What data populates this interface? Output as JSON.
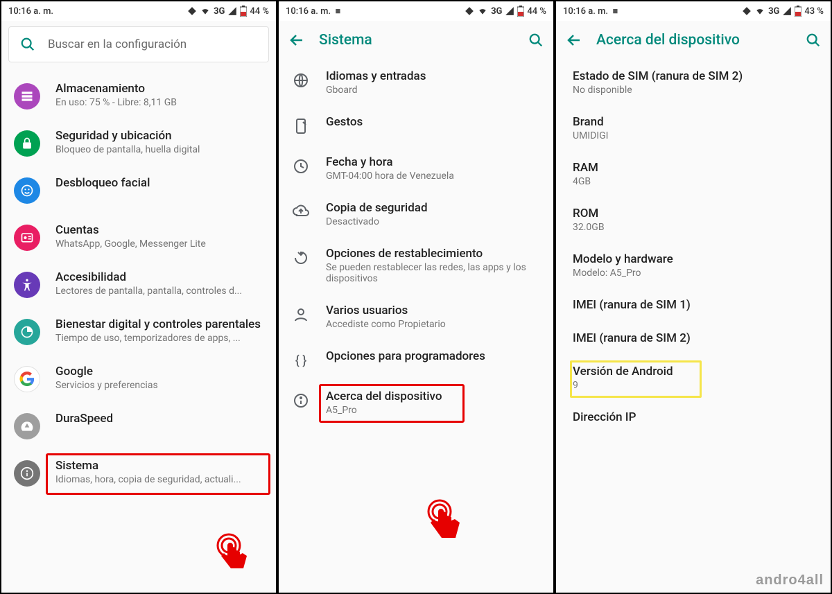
{
  "panels": [
    {
      "statusbar": {
        "time": "10:16 a. m.",
        "extra": "",
        "network": "3G",
        "battery": "44 %"
      },
      "search_placeholder": "Buscar en la configuración",
      "items": [
        {
          "icon": "storage",
          "bg": "#ab47bc",
          "title": "Almacenamiento",
          "sub": "En uso: 75 % - Libre: 8,11 GB"
        },
        {
          "icon": "lock",
          "bg": "#00a152",
          "title": "Seguridad y ubicación",
          "sub": "Bloqueo de pantalla, huella digital"
        },
        {
          "icon": "face",
          "bg": "#1e88e5",
          "title": "Desbloqueo facial",
          "sub": ""
        },
        {
          "icon": "account",
          "bg": "#e91e63",
          "title": "Cuentas",
          "sub": "WhatsApp, Google, Messenger Lite"
        },
        {
          "icon": "accessibility",
          "bg": "#673ab7",
          "title": "Accesibilidad",
          "sub": "Lectores de pantalla, pantalla, controles d..."
        },
        {
          "icon": "wellbeing",
          "bg": "#26a69a",
          "title": "Bienestar digital y controles parentales",
          "sub": "Tiempo de uso, temporizadores de apps, ..."
        },
        {
          "icon": "google",
          "bg": "#ffffff",
          "title": "Google",
          "sub": "Servicios y preferencias"
        },
        {
          "icon": "speed",
          "bg": "#9e9e9e",
          "title": "DuraSpeed",
          "sub": ""
        },
        {
          "icon": "info",
          "bg": "#757575",
          "title": "Sistema",
          "sub": "Idiomas, hora, copia de seguridad, actuali..."
        }
      ]
    },
    {
      "statusbar": {
        "time": "10:16 a. m.",
        "extra": "■",
        "network": "3G",
        "battery": "44 %"
      },
      "appbar_title": "Sistema",
      "items": [
        {
          "icon": "globe",
          "title": "Idiomas y entradas",
          "sub": "Gboard"
        },
        {
          "icon": "gesture",
          "title": "Gestos",
          "sub": ""
        },
        {
          "icon": "clock",
          "title": "Fecha y hora",
          "sub": "GMT-04:00 hora de Venezuela"
        },
        {
          "icon": "backup",
          "title": "Copia de seguridad",
          "sub": "Desactivado"
        },
        {
          "icon": "reset",
          "title": "Opciones de restablecimiento",
          "sub": "Se pueden restablecer las redes, las apps y los dispositivos"
        },
        {
          "icon": "user",
          "title": "Varios usuarios",
          "sub": "Accediste como Propietario"
        },
        {
          "icon": "braces",
          "title": "Opciones para programadores",
          "sub": ""
        },
        {
          "icon": "info",
          "title": "Acerca del dispositivo",
          "sub": "A5_Pro"
        }
      ]
    },
    {
      "statusbar": {
        "time": "10:16 a. m.",
        "extra": "■",
        "network": "3G",
        "battery": "43 %"
      },
      "appbar_title": "Acerca del dispositivo",
      "items": [
        {
          "title": "Estado de SIM (ranura de SIM 2)",
          "sub": "No disponible"
        },
        {
          "title": "Brand",
          "sub": "UMIDIGI"
        },
        {
          "title": "RAM",
          "sub": "4GB"
        },
        {
          "title": "ROM",
          "sub": "32.0GB"
        },
        {
          "title": "Modelo y hardware",
          "sub": "Modelo: A5_Pro"
        },
        {
          "title": "IMEI (ranura de SIM 1)",
          "sub": ""
        },
        {
          "title": "IMEI (ranura de SIM 2)",
          "sub": ""
        },
        {
          "title": "Versión de Android",
          "sub": "9"
        },
        {
          "title": "Dirección IP",
          "sub": ""
        }
      ],
      "watermark": "andro4all"
    }
  ]
}
